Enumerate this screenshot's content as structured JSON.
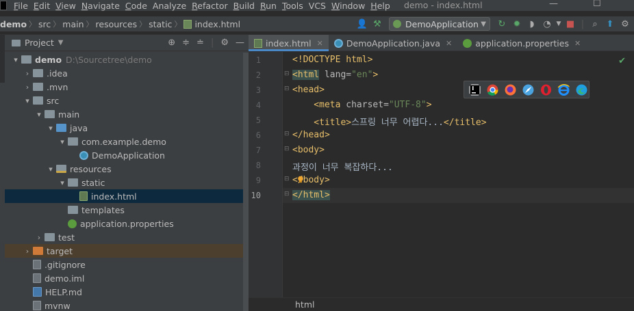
{
  "menubar": {
    "items": [
      {
        "label": "File",
        "mnemonic": "F",
        "rest": "ile"
      },
      {
        "label": "Edit",
        "mnemonic": "E",
        "rest": "dit"
      },
      {
        "label": "View",
        "mnemonic": "V",
        "rest": "iew"
      },
      {
        "label": "Navigate",
        "mnemonic": "N",
        "rest": "avigate"
      },
      {
        "label": "Code",
        "mnemonic": "C",
        "rest": "ode"
      },
      {
        "label": "Analyze",
        "mnemonic": "",
        "rest": "Analyze"
      },
      {
        "label": "Refactor",
        "mnemonic": "R",
        "rest": "efactor"
      },
      {
        "label": "Build",
        "mnemonic": "B",
        "rest": "uild"
      },
      {
        "label": "Run",
        "mnemonic": "R",
        "rest": "un"
      },
      {
        "label": "Tools",
        "mnemonic": "T",
        "rest": "ools"
      },
      {
        "label": "VCS",
        "mnemonic": "",
        "rest": "VCS"
      },
      {
        "label": "Window",
        "mnemonic": "W",
        "rest": "indow"
      },
      {
        "label": "Help",
        "mnemonic": "H",
        "rest": "elp"
      }
    ],
    "window_title": "demo - index.html",
    "minimize": "—",
    "maximize": "☐"
  },
  "breadcrumb": [
    "demo",
    "src",
    "main",
    "resources",
    "static",
    "index.html"
  ],
  "run_config": {
    "label": "DemoApplication"
  },
  "project_panel": {
    "title": "Project",
    "tree": [
      {
        "indent": 0,
        "arrow": "▾",
        "icon": "folder",
        "label": "demo",
        "extra": "D:\\Sourcetree\\demo",
        "bold": true
      },
      {
        "indent": 1,
        "arrow": "›",
        "icon": "folder",
        "label": ".idea"
      },
      {
        "indent": 1,
        "arrow": "›",
        "icon": "folder",
        "label": ".mvn"
      },
      {
        "indent": 1,
        "arrow": "▾",
        "icon": "folder",
        "label": "src"
      },
      {
        "indent": 2,
        "arrow": "▾",
        "icon": "folder",
        "label": "main"
      },
      {
        "indent": 3,
        "arrow": "▾",
        "icon": "folder-blue",
        "label": "java"
      },
      {
        "indent": 4,
        "arrow": "▾",
        "icon": "package",
        "label": "com.example.demo"
      },
      {
        "indent": 5,
        "arrow": "",
        "icon": "file-class",
        "label": "DemoApplication"
      },
      {
        "indent": 3,
        "arrow": "▾",
        "icon": "folder-res",
        "label": "resources"
      },
      {
        "indent": 4,
        "arrow": "▾",
        "icon": "folder",
        "label": "static"
      },
      {
        "indent": 5,
        "arrow": "",
        "icon": "file-html",
        "label": "index.html",
        "selected": true
      },
      {
        "indent": 4,
        "arrow": "",
        "icon": "folder",
        "label": "templates"
      },
      {
        "indent": 4,
        "arrow": "",
        "icon": "file-props",
        "label": "application.properties"
      },
      {
        "indent": 2,
        "arrow": "›",
        "icon": "folder",
        "label": "test"
      },
      {
        "indent": 1,
        "arrow": "›",
        "icon": "folder-orange",
        "label": "target",
        "excluded": true
      },
      {
        "indent": 1,
        "arrow": "",
        "icon": "file-generic",
        "label": ".gitignore"
      },
      {
        "indent": 1,
        "arrow": "",
        "icon": "file-generic",
        "label": "demo.iml"
      },
      {
        "indent": 1,
        "arrow": "",
        "icon": "file-md",
        "label": "HELP.md"
      },
      {
        "indent": 1,
        "arrow": "",
        "icon": "file-generic",
        "label": "mvnw"
      }
    ]
  },
  "editor_tabs": [
    {
      "label": "index.html",
      "active": true,
      "icon": "html-file-icon"
    },
    {
      "label": "DemoApplication.java",
      "active": false,
      "icon": "class-file-icon"
    },
    {
      "label": "application.properties",
      "active": false,
      "icon": "properties-file-icon"
    }
  ],
  "editor": {
    "line_numbers": [
      "1",
      "2",
      "3",
      "4",
      "5",
      "6",
      "7",
      "8",
      "9",
      "10"
    ],
    "current_line": "10",
    "lines": {
      "l1": "<!DOCTYPE html>",
      "l2_open": "<html",
      "l2_attr": " lang=",
      "l2_val": "\"en\"",
      "l2_close": ">",
      "l3": "<head>",
      "l4_open": "    <meta",
      "l4_attr": " charset=",
      "l4_val": "\"UTF-8\"",
      "l4_close": ">",
      "l5_open": "    <title>",
      "l5_text": "스프링 너무 어렵다...",
      "l5_close": "</title>",
      "l6": "</head>",
      "l7": "<body>",
      "l8": "과정이 너무 복잡하다...",
      "l9_a": "<",
      "l9_b": "/body>",
      "l10": "</html>"
    },
    "language": "html"
  },
  "browser_icons": [
    "intellij-icon",
    "chrome-icon",
    "firefox-icon",
    "safari-icon",
    "opera-icon",
    "ie-icon",
    "edge-icon"
  ]
}
